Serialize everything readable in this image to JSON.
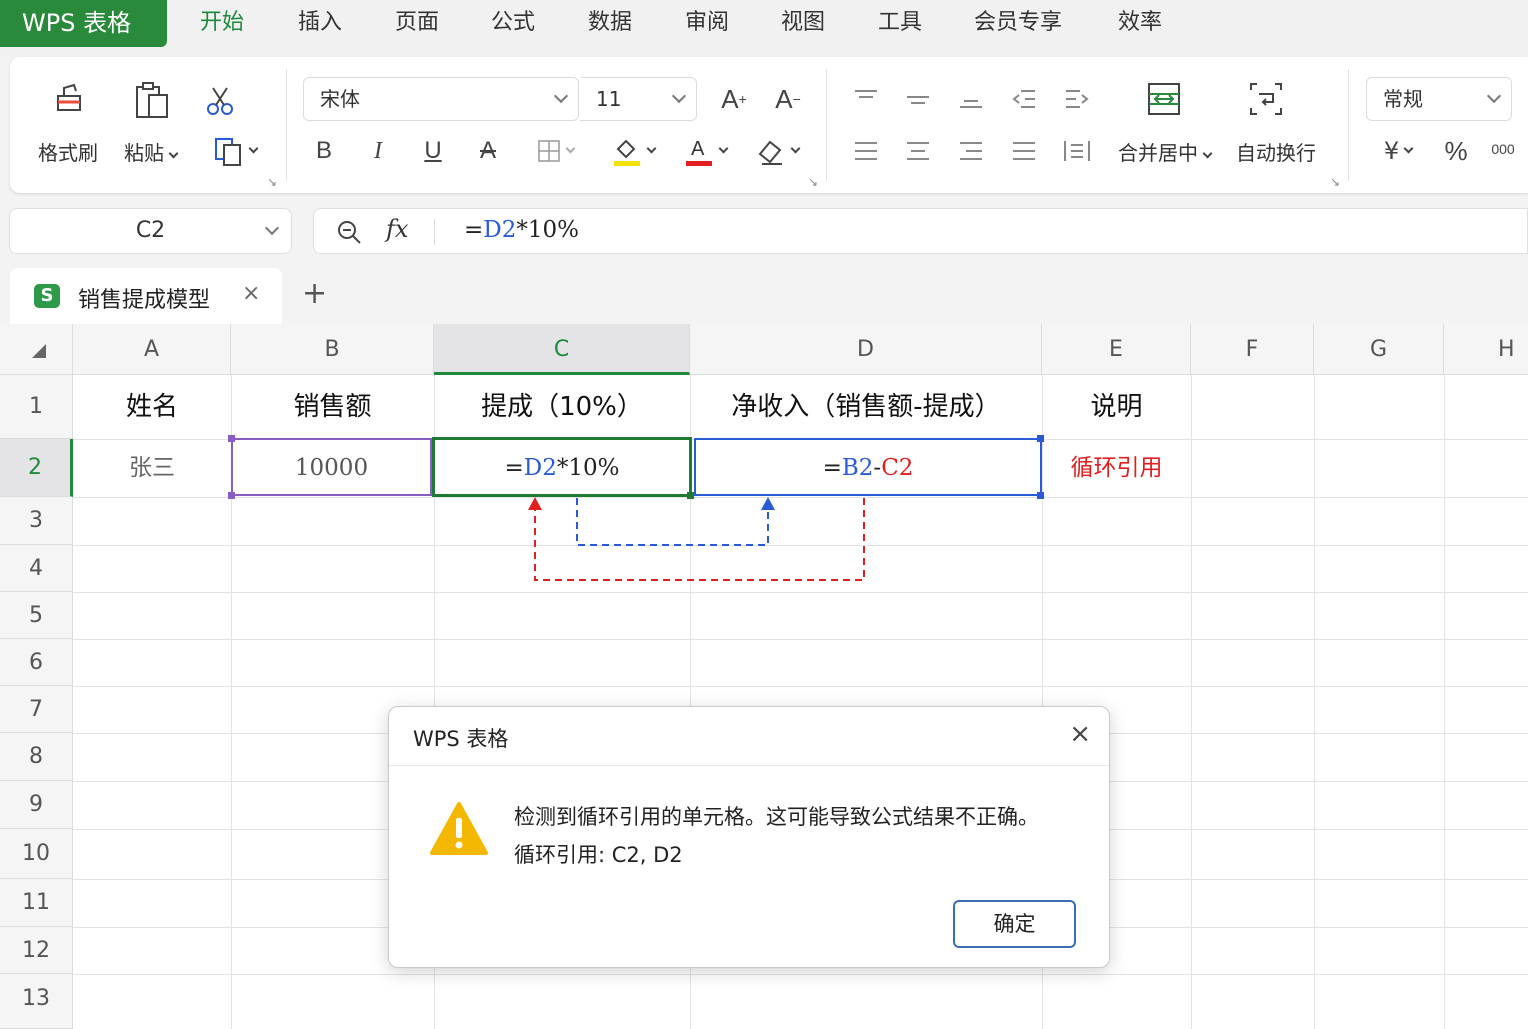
{
  "app": {
    "title": "WPS 表格"
  },
  "menu": {
    "items": [
      "开始",
      "插入",
      "页面",
      "公式",
      "数据",
      "审阅",
      "视图",
      "工具",
      "会员专享",
      "效率"
    ]
  },
  "ribbon": {
    "format_painter": "格式刷",
    "paste": "粘贴",
    "font_name": "宋体",
    "font_size": "11",
    "bold": "B",
    "italic": "I",
    "underline": "U",
    "strike": "A",
    "merge_center": "合并居中",
    "wrap_text": "自动换行",
    "number_format": "常规",
    "currency": "¥",
    "percent": "%",
    "thousands": "000"
  },
  "formula_bar": {
    "name_box": "C2",
    "fx": "fx",
    "formula_prefix": "=",
    "formula_ref": "D2",
    "formula_suffix": "*10%"
  },
  "sheet": {
    "tab_name": "销售提成模型",
    "tab_icon": "S",
    "close": "×",
    "add": "+"
  },
  "grid": {
    "columns": [
      "A",
      "B",
      "C",
      "D",
      "E",
      "F",
      "G",
      "H"
    ],
    "rows": [
      "1",
      "2",
      "3",
      "4",
      "5",
      "6",
      "7",
      "8",
      "9",
      "10",
      "11",
      "12",
      "13"
    ],
    "header_row": [
      "姓名",
      "销售额",
      "提成（10%）",
      "净收入（销售额-提成）",
      "说明"
    ],
    "row2": {
      "name": "张三",
      "sales": "10000",
      "c2_prefix": "=",
      "c2_ref": "D2",
      "c2_suffix": "*10%",
      "d2_prefix": "=",
      "d2_ref1": "B2",
      "d2_minus": "-",
      "d2_ref2": "C2",
      "note": "循环引用"
    }
  },
  "dialog": {
    "title": "WPS 表格",
    "close": "×",
    "message": "检测到循环引用的单元格。这可能导致公式结果不正确。",
    "detail": "循环引用: C2, D2",
    "ok": "确定"
  },
  "colors": {
    "brand_green": "#2a8a3c",
    "ref_blue": "#2a5bd7",
    "ref_red": "#e02020",
    "purple_border": "#8a5cc6",
    "warning_yellow": "#f5b800"
  }
}
